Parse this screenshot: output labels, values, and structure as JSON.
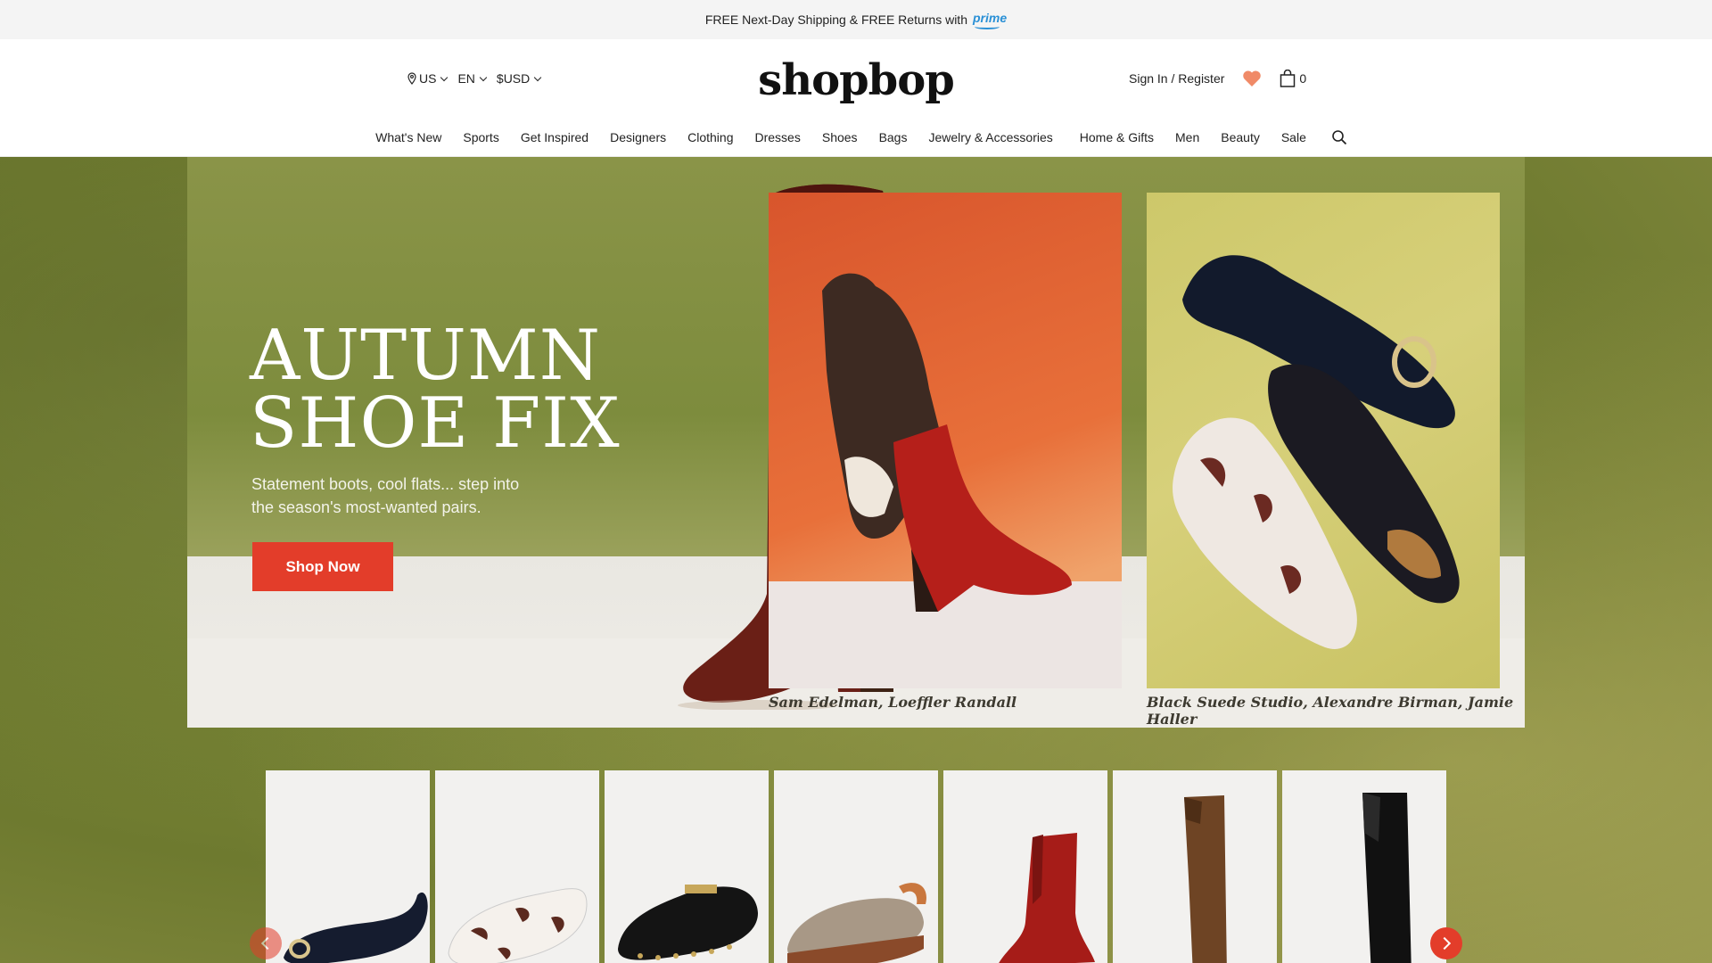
{
  "promo": {
    "text": "FREE Next-Day Shipping & FREE Returns with",
    "brand": "prime"
  },
  "header": {
    "locale": {
      "country": "US",
      "language": "EN",
      "currency": "$USD"
    },
    "logo": "shopbop",
    "sign_in": "Sign In / Register",
    "cart_count": "0",
    "icons": [
      "location-pin-icon",
      "heart-icon",
      "shopping-bag-icon",
      "search-icon"
    ]
  },
  "nav": {
    "items": [
      "What's New",
      "Sports",
      "Get Inspired",
      "Designers",
      "Clothing",
      "Dresses",
      "Shoes",
      "Bags",
      "Jewelry & Accessories",
      "Home & Gifts",
      "Men",
      "Beauty",
      "Sale"
    ]
  },
  "hero": {
    "headline_line1": "AUTUMN",
    "headline_line2": "SHOE FIX",
    "subhead": "Statement boots, cool flats... step into the season's most-wanted pairs.",
    "cta": "Shop Now",
    "caption_left": "Sam Edelman, Loeffler Randall",
    "caption_right": "Black Suede Studio, Alexandre Birman, Jamie Haller"
  },
  "colors": {
    "accent": "#e33d2a",
    "olive": "#7b8838",
    "prime_blue": "#2a90d6"
  },
  "carousel": {
    "items": [
      "navy suede flat with gold buckle",
      "cow print loafer",
      "black studded clog",
      "monogram slingback clog",
      "red western ankle boot",
      "brown woven knee boot",
      "black leather knee boot"
    ]
  }
}
